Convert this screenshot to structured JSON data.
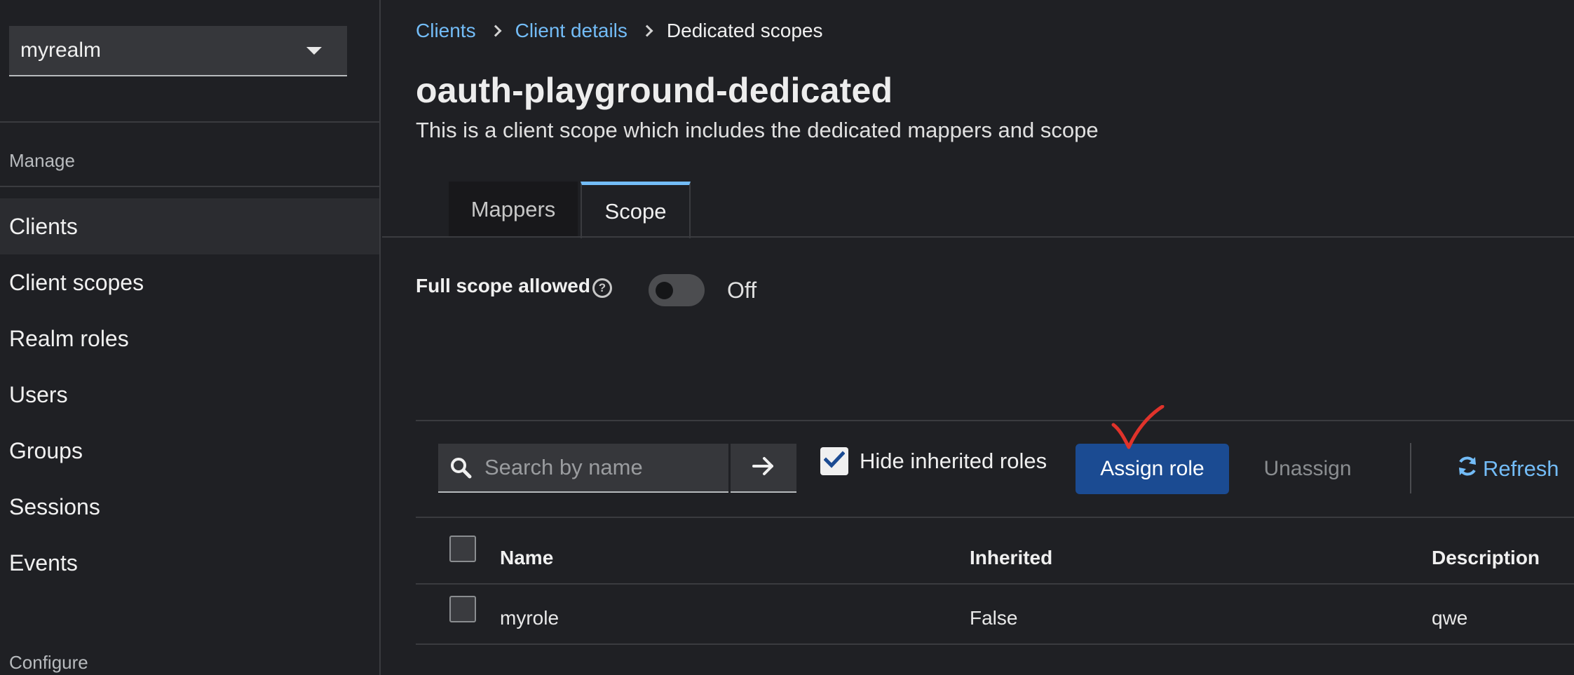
{
  "sidebar": {
    "realm": "myrealm",
    "sections": {
      "manage": "Manage",
      "configure": "Configure"
    },
    "items": [
      {
        "label": "Clients",
        "active": true
      },
      {
        "label": "Client scopes"
      },
      {
        "label": "Realm roles"
      },
      {
        "label": "Users"
      },
      {
        "label": "Groups"
      },
      {
        "label": "Sessions"
      },
      {
        "label": "Events"
      }
    ]
  },
  "breadcrumb": {
    "items": [
      "Clients",
      "Client details"
    ],
    "current": "Dedicated scopes"
  },
  "header": {
    "title": "oauth-playground-dedicated",
    "subtitle": "This is a client scope which includes the dedicated mappers and scope"
  },
  "tabs": [
    {
      "label": "Mappers",
      "active": false
    },
    {
      "label": "Scope",
      "active": true
    }
  ],
  "full_scope": {
    "label": "Full scope allowed",
    "help_icon": "question-circle-icon",
    "state": "Off",
    "enabled": false
  },
  "toolbar": {
    "search_placeholder": "Search by name",
    "search_value": "",
    "hide_inherited_label": "Hide inherited roles",
    "hide_inherited_checked": true,
    "assign_label": "Assign role",
    "unassign_label": "Unassign",
    "refresh_label": "Refresh"
  },
  "table": {
    "columns": [
      "Name",
      "Inherited",
      "Description"
    ],
    "rows": [
      {
        "name": "myrole",
        "inherited": "False",
        "description": "qwe"
      }
    ]
  },
  "colors": {
    "accent": "#73bcf7",
    "primary_button": "#1b4b92",
    "annotation": "#e0332b"
  }
}
